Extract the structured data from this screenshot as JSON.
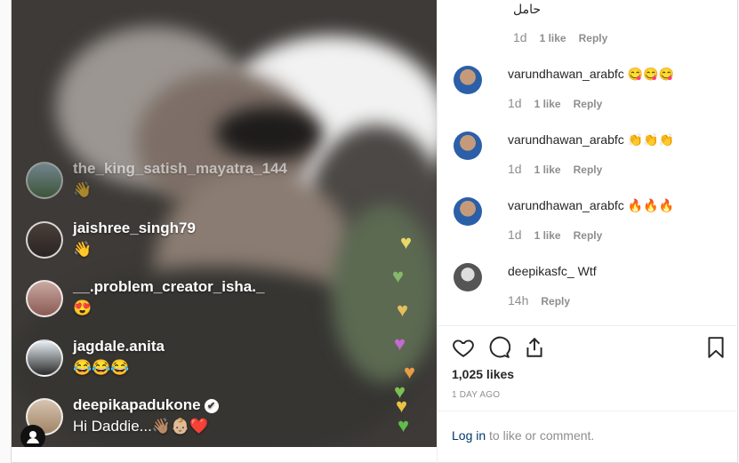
{
  "live": {
    "comments": [
      {
        "user": "the_king_satish_mayatra_144",
        "message": "👋"
      },
      {
        "user": "jaishree_singh79",
        "message": "👋"
      },
      {
        "user": "__.problem_creator_isha._",
        "message": "😍"
      },
      {
        "user": "jagdale.anita",
        "message": "😂😂😂"
      },
      {
        "user": "deepikapadukone",
        "message": "Hi Daddie...👋🏽👶🏼❤️"
      }
    ]
  },
  "comments": [
    {
      "text": "حامل",
      "age": "1d",
      "likes": "1 like",
      "reply": "Reply"
    },
    {
      "user": "varundhawan_arabfc",
      "text": "😋😋😋",
      "age": "1d",
      "likes": "1 like",
      "reply": "Reply"
    },
    {
      "user": "varundhawan_arabfc",
      "text": "👏👏👏",
      "age": "1d",
      "likes": "1 like",
      "reply": "Reply"
    },
    {
      "user": "varundhawan_arabfc",
      "text": "🔥🔥🔥",
      "age": "1d",
      "likes": "1 like",
      "reply": "Reply"
    },
    {
      "user": "deepikasfc_",
      "text": "Wtf",
      "age": "14h",
      "reply": "Reply"
    }
  ],
  "post": {
    "likes": "1,025 likes",
    "date": "1 DAY AGO"
  },
  "login": {
    "link": "Log in",
    "rest": " to like or comment."
  },
  "icons": {
    "like": "heart-outline-icon",
    "comment": "speech-bubble-icon",
    "share": "share-icon",
    "save": "bookmark-icon",
    "account": "account-icon",
    "verified": "verified-badge-icon"
  }
}
